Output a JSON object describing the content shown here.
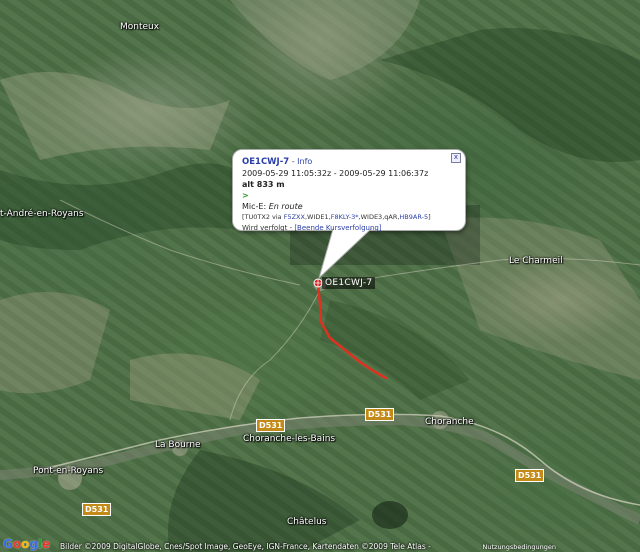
{
  "map": {
    "towns": [
      {
        "name": "Monteux"
      },
      {
        "name": "t-André-en-Royans"
      },
      {
        "name": "Le Charmeil"
      },
      {
        "name": "La Bourne"
      },
      {
        "name": "Choranche-les-Bains"
      },
      {
        "name": "Choranche"
      },
      {
        "name": "Pont-en-Royans"
      },
      {
        "name": "Châtelus"
      }
    ],
    "road_shields": [
      "D531",
      "D531",
      "D531",
      "D531"
    ],
    "station_label": "OE1CWJ-7",
    "track_color": "#e03020"
  },
  "popup": {
    "callsign": "OE1CWJ-7",
    "separator": " - ",
    "info_link": "Info",
    "time_range": "2009-05-29 11:05:32z - 2009-05-29 11:06:37z",
    "altitude": "alt 833 m",
    "arrow": ">",
    "mic_e_label": "Mic-E: ",
    "mic_e_status": "En route",
    "path_prefix": "[TU0TX2 via ",
    "path_hop1": "F5ZXX",
    "path_mid1": ",WIDE1,",
    "path_hop2": "F8KLY-3*",
    "path_mid2": ",WIDE3,qAR,",
    "path_hop3": "HB9AR-5",
    "path_suffix": "]",
    "tracked_label": "Wird verfolgt - ",
    "stop_tracking_link": "[Beende Kursverfolgung]",
    "close_symbol": "x"
  },
  "footer": {
    "google_letters": [
      "G",
      "o",
      "o",
      "g",
      "l",
      "e"
    ],
    "copyright": "Bilder ©2009 DigitalGlobe, Cnes/Spot Image, GeoEye, IGN-France, Kartendaten ©2009 Tele Atlas -",
    "terms": "Nutzungsbedingungen"
  }
}
